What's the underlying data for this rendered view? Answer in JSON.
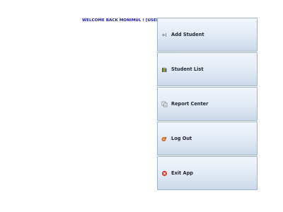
{
  "header": {
    "welcome_text": "WELCOME BACK MONIMUL ! [USER]"
  },
  "menu": {
    "items": [
      {
        "label": "Add Student",
        "icon": "add-user-icon"
      },
      {
        "label": "Student List",
        "icon": "books-icon"
      },
      {
        "label": "Report Center",
        "icon": "report-icon"
      },
      {
        "label": "Log Out",
        "icon": "logout-icon"
      },
      {
        "label": "Exit App",
        "icon": "exit-icon"
      }
    ]
  },
  "colors": {
    "welcome_text": "#1a1aa6",
    "button_border": "#9fb3cf"
  }
}
